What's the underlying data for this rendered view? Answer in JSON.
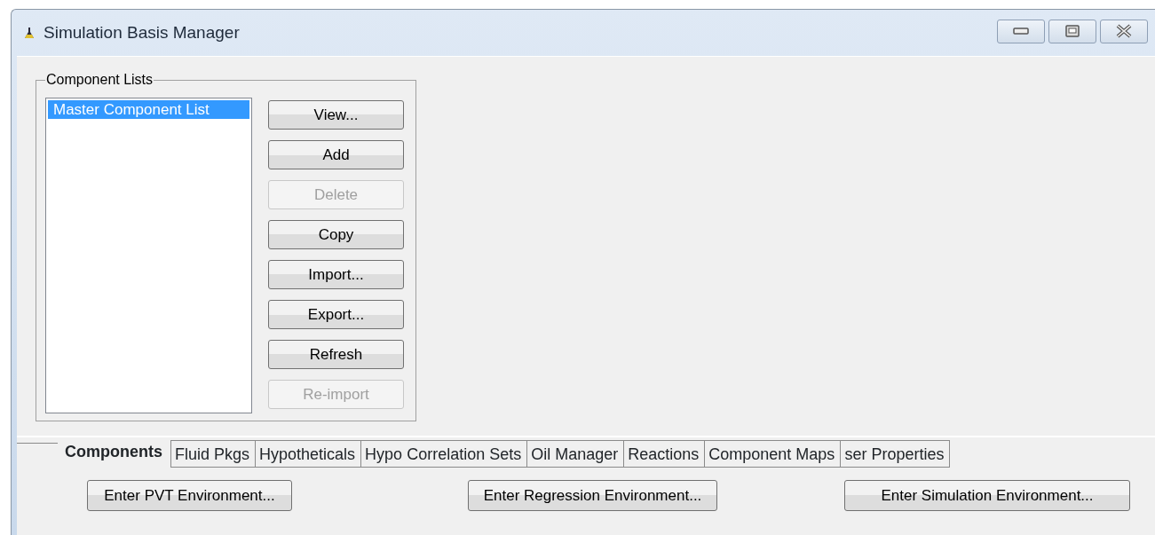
{
  "window": {
    "title": "Simulation Basis Manager"
  },
  "component_lists": {
    "title": "Component Lists",
    "items": [
      {
        "label": "Master Component List",
        "selected": true
      }
    ],
    "buttons": [
      {
        "label": "View...",
        "disabled": false
      },
      {
        "label": "Add",
        "disabled": false
      },
      {
        "label": "Delete",
        "disabled": true
      },
      {
        "label": "Copy",
        "disabled": false
      },
      {
        "label": "Import...",
        "disabled": false
      },
      {
        "label": "Export...",
        "disabled": false
      },
      {
        "label": "Refresh",
        "disabled": false
      },
      {
        "label": "Re-import",
        "disabled": true
      }
    ]
  },
  "tabs": [
    {
      "label": "Components",
      "selected": true
    },
    {
      "label": "Fluid Pkgs",
      "selected": false
    },
    {
      "label": "Hypotheticals",
      "selected": false
    },
    {
      "label": "Hypo Correlation Sets",
      "selected": false
    },
    {
      "label": "Oil Manager",
      "selected": false
    },
    {
      "label": "Reactions",
      "selected": false
    },
    {
      "label": "Component Maps",
      "selected": false
    },
    {
      "label": "ser Properties",
      "selected": false
    }
  ],
  "environment_buttons": [
    "Enter PVT Environment...",
    "Enter Regression Environment...",
    "Enter Simulation Environment..."
  ]
}
